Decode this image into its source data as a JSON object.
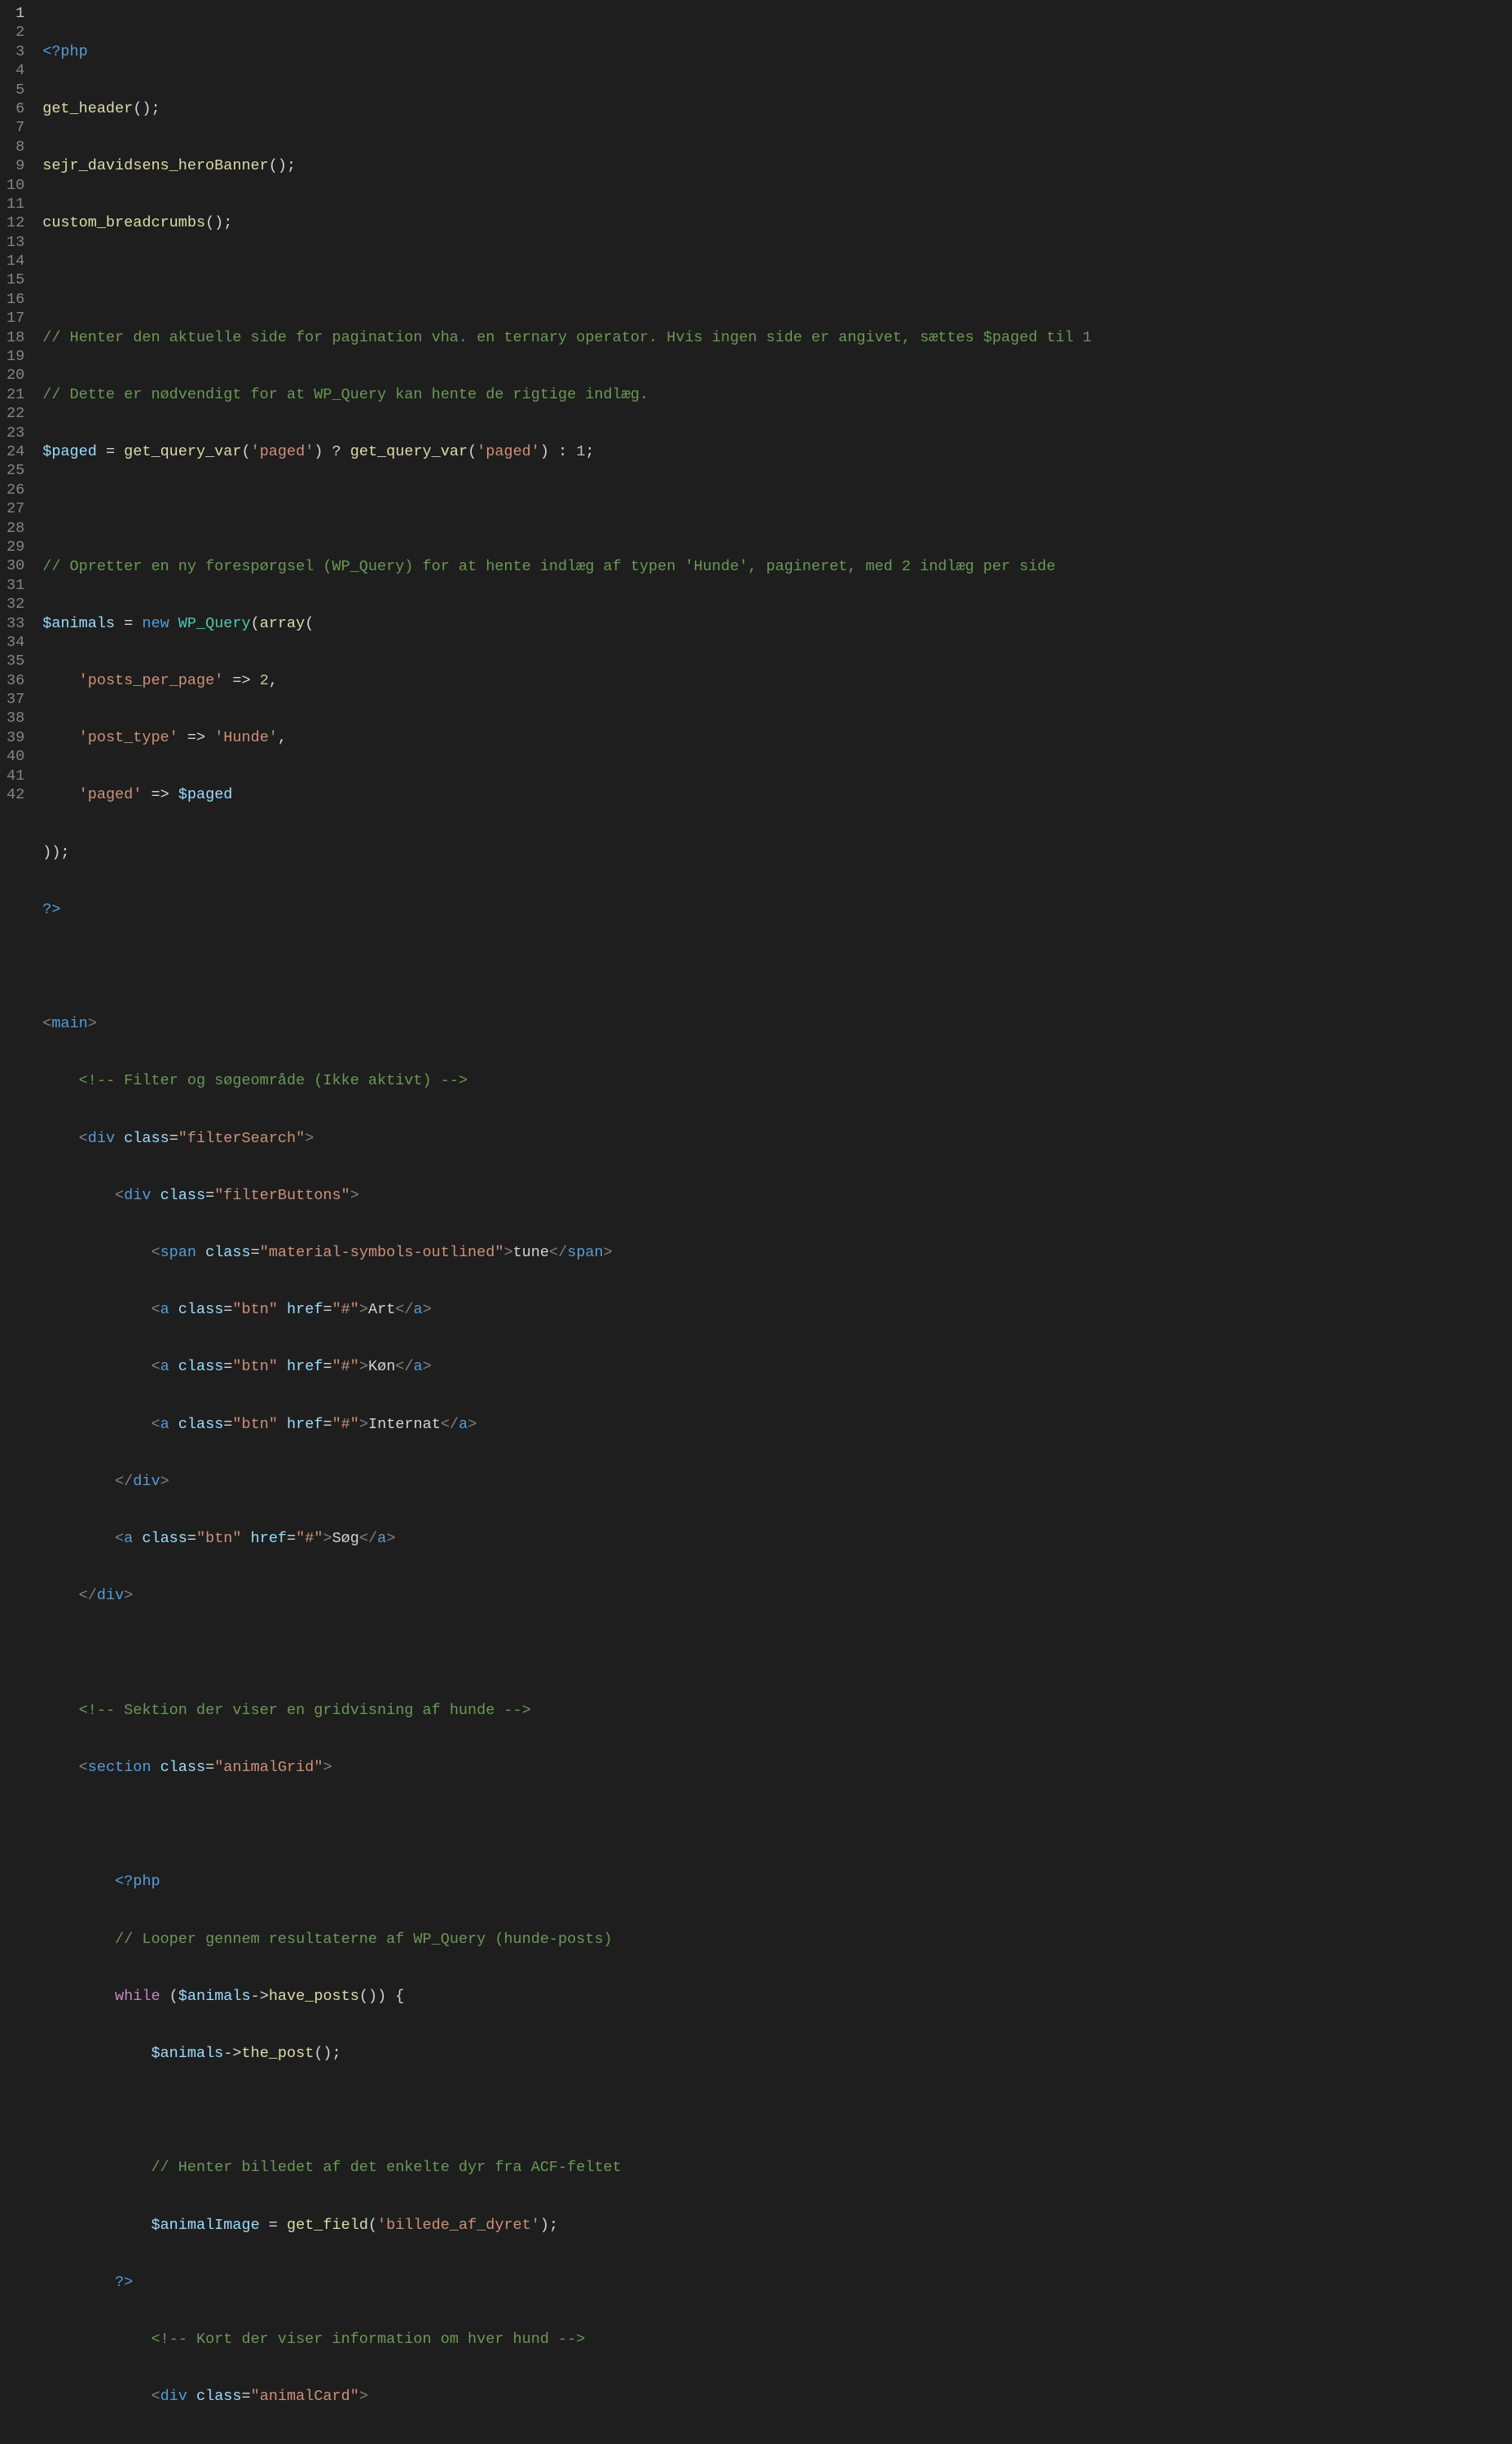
{
  "gutter": {
    "lines": [
      "1",
      "2",
      "3",
      "4",
      "5",
      "6",
      "7",
      "8",
      "9",
      "10",
      "11",
      "12",
      "13",
      "14",
      "15",
      "16",
      "17",
      "18",
      "19",
      "20",
      "21",
      "22",
      "23",
      "24",
      "25",
      "26",
      "27",
      "28",
      "29",
      "30",
      "31",
      "32",
      "33",
      "34",
      "35",
      "36",
      "37",
      "38",
      "39",
      "40",
      "41",
      "42"
    ]
  },
  "code": {
    "l1": {
      "php_open": "<?php"
    },
    "l2": {
      "fn": "get_header",
      "p": "();"
    },
    "l3": {
      "fn": "sejr_davidsens_heroBanner",
      "p": "();"
    },
    "l4": {
      "fn": "custom_breadcrumbs",
      "p": "();"
    },
    "l6": {
      "c": "// Henter den aktuelle side for pagination vha. en ternary operator. Hvis ingen side er angivet, sættes $paged til 1"
    },
    "l7": {
      "c": "// Dette er nødvendigt for at WP_Query kan hente de rigtige indlæg."
    },
    "l8": {
      "var": "$paged",
      "eq": " = ",
      "fn1": "get_query_var",
      "po1": "(",
      "s1": "'paged'",
      "pc1": ") ? ",
      "fn2": "get_query_var",
      "po2": "(",
      "s2": "'paged'",
      "pc2": ") : ",
      "n": "1",
      "end": ";"
    },
    "l10": {
      "c": "// Opretter en ny forespørgsel (WP_Query) for at hente indlæg af typen 'Hunde', pagineret, med 2 indlæg per side"
    },
    "l11": {
      "var": "$animals",
      "eq": " = ",
      "new": "new ",
      "cls": "WP_Query",
      "po": "(",
      "arr": "array",
      "po2": "("
    },
    "l12": {
      "indent": "    ",
      "s": "'posts_per_page'",
      "arrow": " => ",
      "n": "2",
      "comma": ","
    },
    "l13": {
      "indent": "    ",
      "s": "'post_type'",
      "arrow": " => ",
      "s2": "'Hunde'",
      "comma": ","
    },
    "l14": {
      "indent": "    ",
      "s": "'paged'",
      "arrow": " => ",
      "var": "$paged"
    },
    "l15": {
      "p": "));"
    },
    "l16": {
      "php_close": "?>"
    },
    "l18": {
      "br1": "<",
      "tag": "main",
      "br2": ">"
    },
    "l19": {
      "indent": "    ",
      "c": "<!-- Filter og søgeområde (Ikke aktivt) -->"
    },
    "l20": {
      "indent": "    ",
      "br1": "<",
      "tag": "div",
      "sp": " ",
      "attr": "class",
      "eq": "=",
      "s": "\"filterSearch\"",
      "br2": ">"
    },
    "l21": {
      "indent": "        ",
      "br1": "<",
      "tag": "div",
      "sp": " ",
      "attr": "class",
      "eq": "=",
      "s": "\"filterButtons\"",
      "br2": ">"
    },
    "l22": {
      "indent": "            ",
      "br1": "<",
      "tag": "span",
      "sp": " ",
      "attr": "class",
      "eq": "=",
      "s": "\"material-symbols-outlined\"",
      "br2": ">",
      "txt": "tune",
      "br3": "</",
      "tag2": "span",
      "br4": ">"
    },
    "l23": {
      "indent": "            ",
      "br1": "<",
      "tag": "a",
      "sp": " ",
      "attr": "class",
      "eq": "=",
      "s": "\"btn\"",
      "sp2": " ",
      "attr2": "href",
      "eq2": "=",
      "s2": "\"#\"",
      "br2": ">",
      "txt": "Art",
      "br3": "</",
      "tag2": "a",
      "br4": ">"
    },
    "l24": {
      "indent": "            ",
      "br1": "<",
      "tag": "a",
      "sp": " ",
      "attr": "class",
      "eq": "=",
      "s": "\"btn\"",
      "sp2": " ",
      "attr2": "href",
      "eq2": "=",
      "s2": "\"#\"",
      "br2": ">",
      "txt": "Køn",
      "br3": "</",
      "tag2": "a",
      "br4": ">"
    },
    "l25": {
      "indent": "            ",
      "br1": "<",
      "tag": "a",
      "sp": " ",
      "attr": "class",
      "eq": "=",
      "s": "\"btn\"",
      "sp2": " ",
      "attr2": "href",
      "eq2": "=",
      "s2": "\"#\"",
      "br2": ">",
      "txt": "Internat",
      "br3": "</",
      "tag2": "a",
      "br4": ">"
    },
    "l26": {
      "indent": "        ",
      "br1": "</",
      "tag": "div",
      "br2": ">"
    },
    "l27": {
      "indent": "        ",
      "br1": "<",
      "tag": "a",
      "sp": " ",
      "attr": "class",
      "eq": "=",
      "s": "\"btn\"",
      "sp2": " ",
      "attr2": "href",
      "eq2": "=",
      "s2": "\"#\"",
      "br2": ">",
      "txt": "Søg",
      "br3": "</",
      "tag2": "a",
      "br4": ">"
    },
    "l28": {
      "indent": "    ",
      "br1": "</",
      "tag": "div",
      "br2": ">"
    },
    "l30": {
      "indent": "    ",
      "c": "<!-- Sektion der viser en gridvisning af hunde -->"
    },
    "l31": {
      "indent": "    ",
      "br1": "<",
      "tag": "section",
      "sp": " ",
      "attr": "class",
      "eq": "=",
      "s": "\"animalGrid\"",
      "br2": ">"
    },
    "l33": {
      "indent": "        ",
      "php_open": "<?php"
    },
    "l34": {
      "indent": "        ",
      "c": "// Looper gennem resultaterne af WP_Query (hunde-posts)"
    },
    "l35": {
      "indent": "        ",
      "kw": "while ",
      "po": "(",
      "var": "$animals",
      "arrow": "->",
      "fn": "have_posts",
      "pc": "()) {"
    },
    "l36": {
      "indent": "            ",
      "var": "$animals",
      "arrow": "->",
      "fn": "the_post",
      "pc": "();"
    },
    "l38": {
      "indent": "            ",
      "c": "// Henter billedet af det enkelte dyr fra ACF-feltet"
    },
    "l39": {
      "indent": "            ",
      "var": "$animalImage",
      "eq": " = ",
      "fn": "get_field",
      "po": "(",
      "s": "'billede_af_dyret'",
      "pc": ");"
    },
    "l40": {
      "indent": "        ",
      "php_close": "?>"
    },
    "l41": {
      "indent": "            ",
      "c": "<!-- Kort der viser information om hver hund -->"
    },
    "l42": {
      "indent": "            ",
      "br1": "<",
      "tag": "div",
      "sp": " ",
      "attr": "class",
      "eq": "=",
      "s": "\"animalCard\"",
      "br2": ">"
    }
  }
}
